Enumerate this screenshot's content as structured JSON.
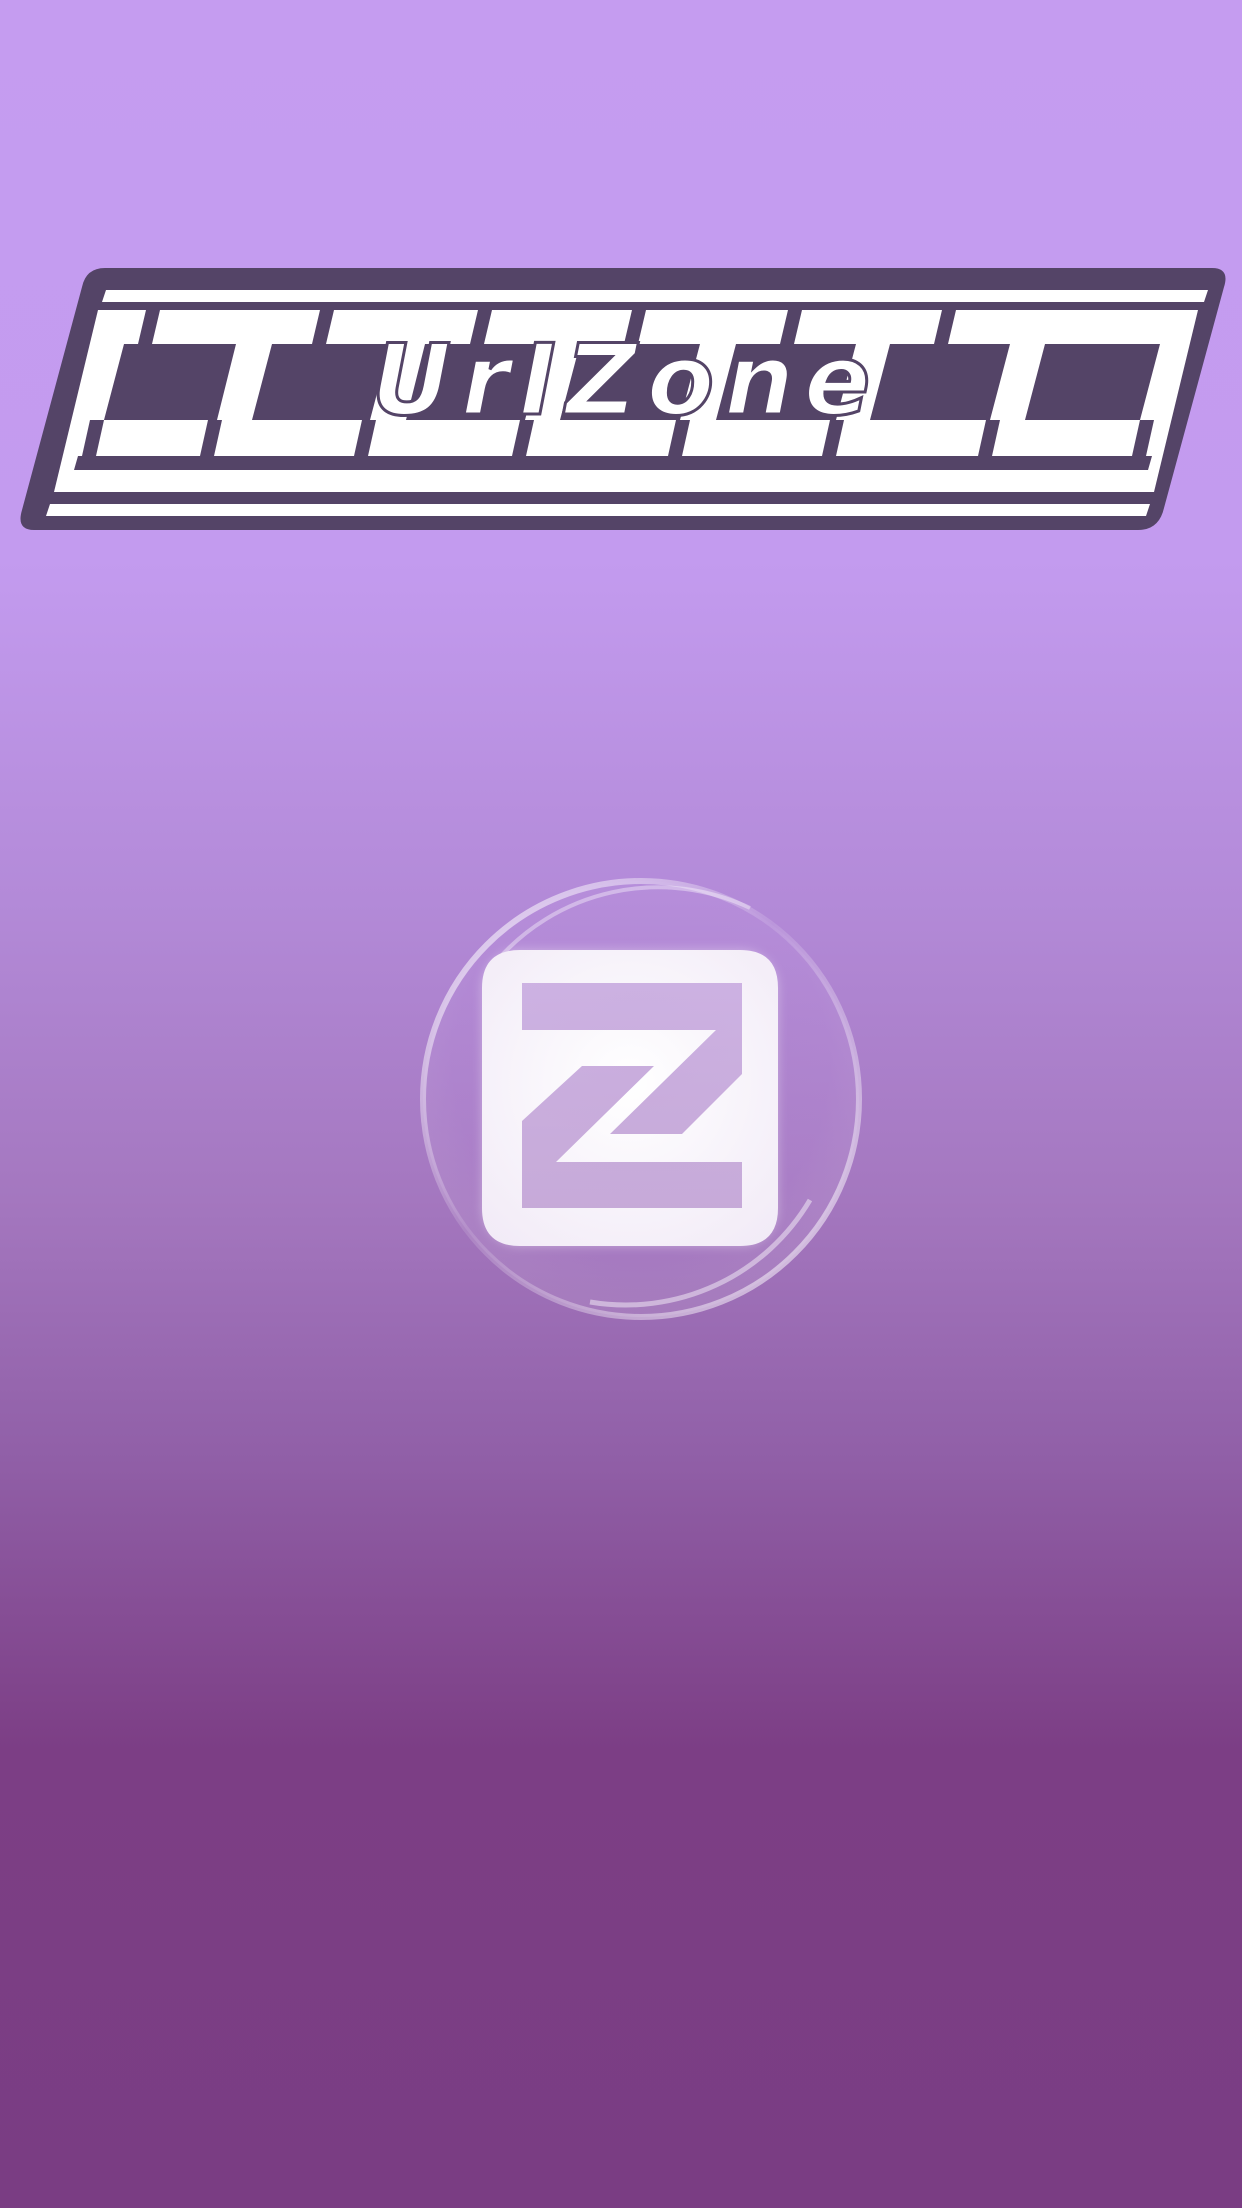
{
  "app": {
    "name": "UrIZone"
  },
  "logo": {
    "wordmark": "UrIZone",
    "stylized_letters": [
      "U",
      "r",
      "I",
      "Z",
      "o",
      "n",
      "e"
    ]
  },
  "badge": {
    "icon": "z-letter-icon"
  },
  "colors": {
    "background_top": "#c59cf0",
    "background_bottom": "#7a3d83",
    "logo_dark": "#544467",
    "logo_light": "#ffffff",
    "badge_fill": "#f8f4fb"
  }
}
